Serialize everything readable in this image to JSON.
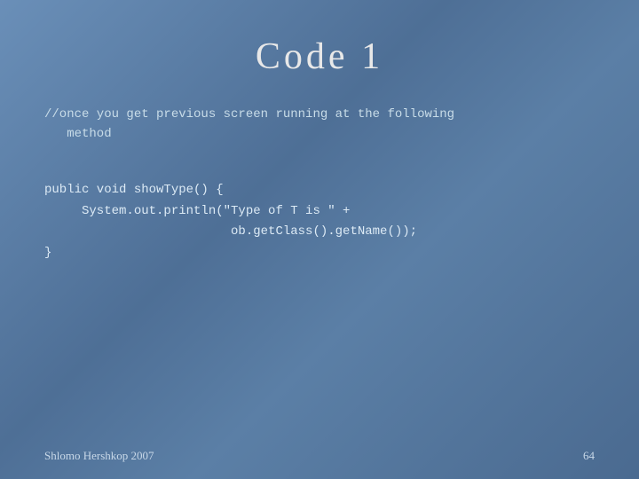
{
  "slide": {
    "title": "Code  1",
    "comment": "//once you get previous screen running at the following\n   method",
    "code": "public void showType() {\n     System.out.println(\"Type of T is \" +\n                         ob.getClass().getName());\n}",
    "footer_left": "Shlomo Hershkop 2007",
    "footer_right": "64"
  }
}
